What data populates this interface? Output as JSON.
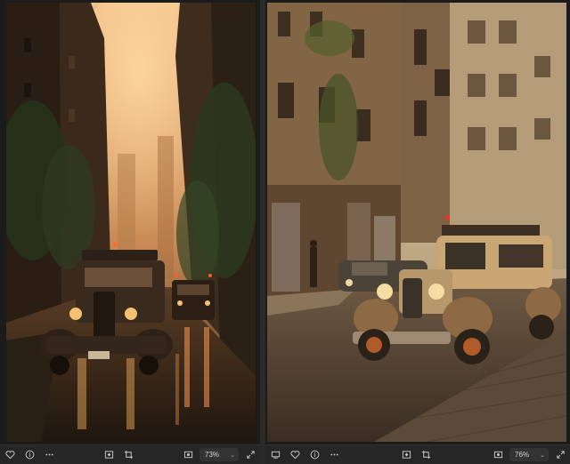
{
  "left_pane": {
    "image_icon": "image-left-street-scene",
    "zoom_label": "73%",
    "icons": [
      "heart-icon",
      "info-icon",
      "more-icon",
      "fit-screen-icon",
      "crop-icon",
      "image-view-icon",
      "zoom-dropdown-chevron-icon",
      "fullscreen-icon"
    ]
  },
  "right_pane": {
    "image_icon": "image-right-street-scene",
    "zoom_label": "76%",
    "icons": [
      "monitor-icon",
      "heart-icon",
      "info-icon",
      "more-icon",
      "fit-screen-icon",
      "crop-icon",
      "image-view-icon",
      "zoom-dropdown-chevron-icon",
      "fullscreen-icon"
    ]
  },
  "colors": {
    "background": "#1b1b1b",
    "toolbar": "#262626",
    "zoom_chip": "#333333",
    "left_sky": "#e6ae6e",
    "right_sky": "#d8c4a0"
  }
}
